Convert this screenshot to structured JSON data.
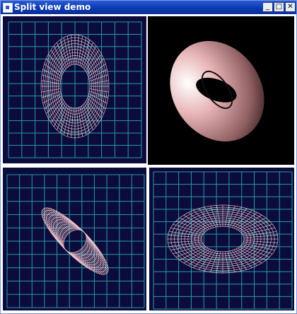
{
  "window": {
    "title": "Split view demo",
    "controls": {
      "minimize": "_",
      "maximize": "□",
      "close": "✕"
    }
  },
  "colors": {
    "viewport_bg": "#0b0b3c",
    "grid": "#2a9aa8",
    "wire": "#f4c6cc",
    "shaded_bg": "#000000",
    "shaded_torus": "#e7b4b6"
  },
  "views": [
    {
      "name": "top-left",
      "mode": "wireframe"
    },
    {
      "name": "top-right",
      "mode": "shaded"
    },
    {
      "name": "bottom-left",
      "mode": "wireframe"
    },
    {
      "name": "bottom-right",
      "mode": "wireframe"
    }
  ]
}
